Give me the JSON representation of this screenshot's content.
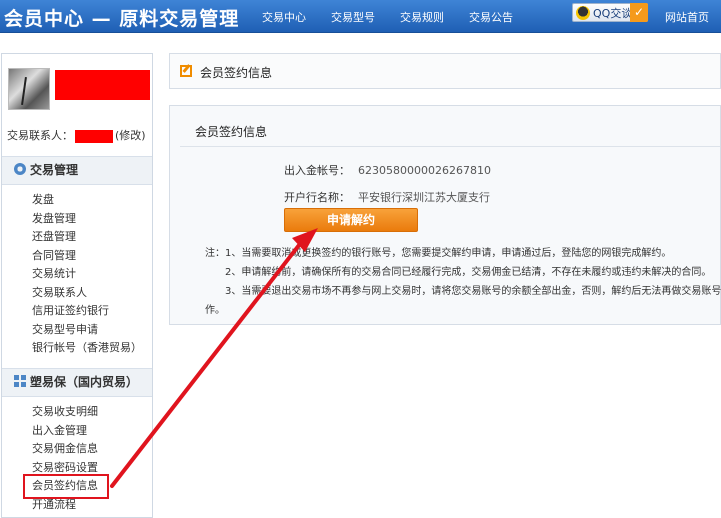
{
  "header": {
    "title": "会员中心 — 原料交易管理",
    "nav": [
      "交易中心",
      "交易型号",
      "交易规则",
      "交易公告"
    ],
    "qq_label": "QQ交谈",
    "home_link": "网站首页"
  },
  "sidebar": {
    "contact_label": "交易联系人：",
    "edit_label": "(修改)",
    "section1_title": "交易管理",
    "section1_items": [
      "发盘",
      "发盘管理",
      "还盘管理",
      "合同管理",
      "交易统计",
      "交易联系人",
      "信用证签约银行",
      "交易型号申请",
      "银行帐号（香港贸易）"
    ],
    "section2_title": "塑易保（国内贸易）",
    "section2_items": [
      "交易收支明细",
      "出入金管理",
      "交易佣金信息",
      "交易密码设置",
      "会员签约信息",
      "开通流程"
    ]
  },
  "panel_title": "会员签约信息",
  "content": {
    "title": "会员签约信息",
    "account_label": "出入金帐号：",
    "account_value": "6230580000026267810",
    "bank_label": "开户行名称：",
    "bank_value": "平安银行深圳江苏大厦支行",
    "apply_button": "申请解约",
    "note1": "注：1、当需要取消或更换签约的银行账号，您需要提交解约申请，申请通过后，登陆您的网银完成解约。",
    "note2": "2、申请解约前，请确保所有的交易合同已经履行完成，交易佣金已结清，不存在未履约或违约未解决的合同。",
    "note3": "3、当需要退出交易市场不再参与网上交易时，请将您交易账号的余额全部出金，否则，解约后无法再做交易账号",
    "note3_cont": "作。"
  },
  "colors": {
    "header_blue": "#2b6fc4",
    "button_orange": "#f0911f",
    "annotation_red": "#e0141e",
    "redaction_red": "#ff0000"
  }
}
